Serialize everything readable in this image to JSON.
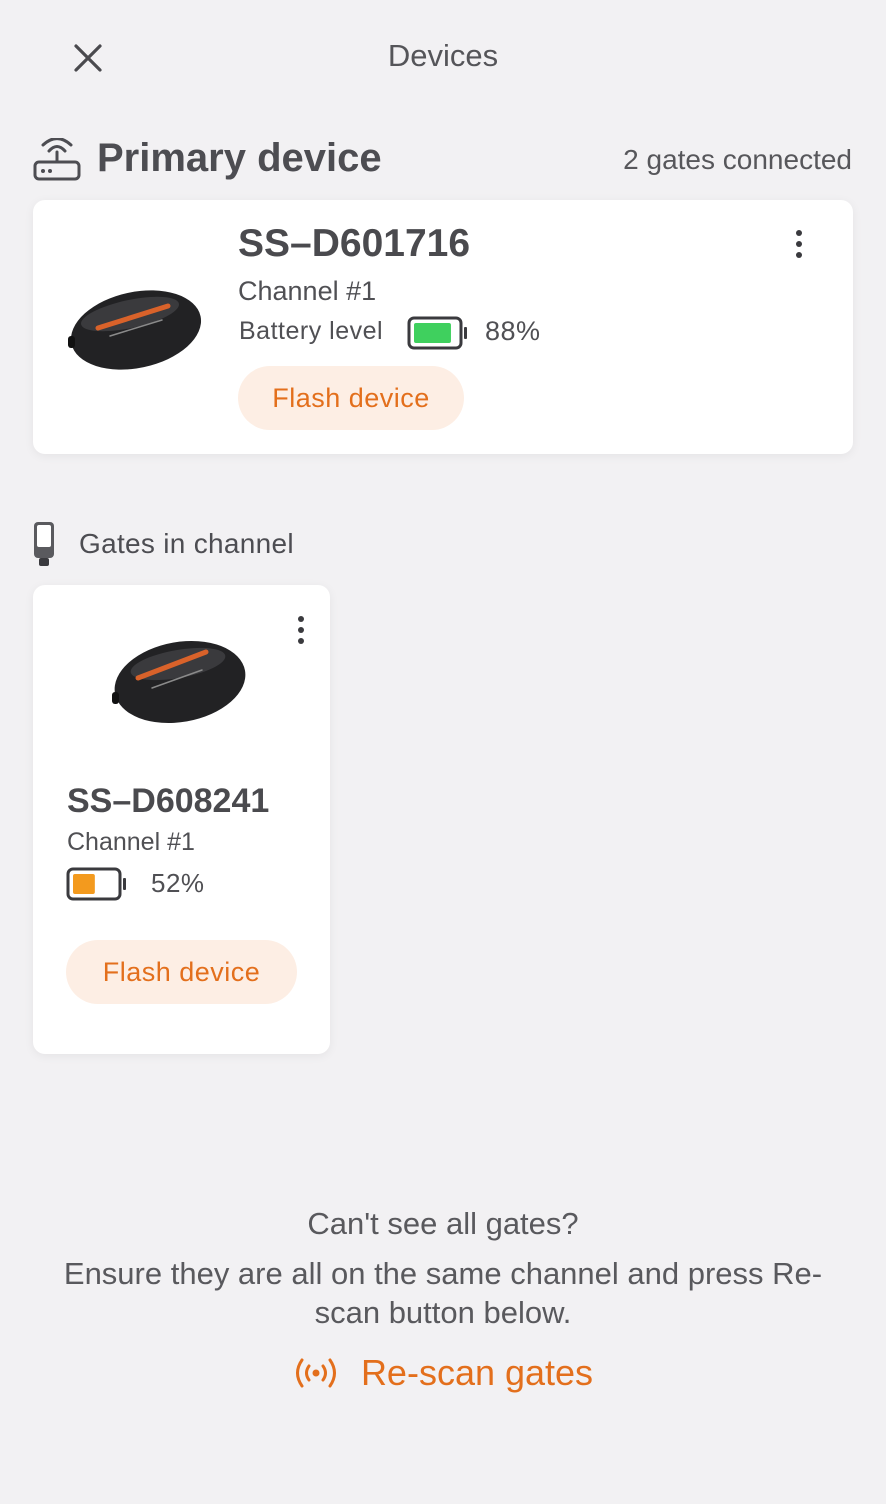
{
  "header": {
    "title": "Devices"
  },
  "primary": {
    "section_title": "Primary device",
    "gates_connected": "2 gates connected",
    "device": {
      "name": "SS–D601716",
      "channel": "Channel #1",
      "battery_label": "Battery level",
      "battery_percent": "88%",
      "battery_level": 0.88,
      "battery_color": "#3fd05e",
      "flash_label": "Flash device"
    }
  },
  "gates": {
    "section_title": "Gates in channel",
    "items": [
      {
        "name": "SS–D608241",
        "channel": "Channel #1",
        "battery_percent": "52%",
        "battery_level": 0.52,
        "battery_color": "#f39a1e",
        "flash_label": "Flash device"
      }
    ]
  },
  "footer": {
    "question": "Can't see all gates?",
    "instructions": "Ensure they are all on the same channel and press Re-scan button below.",
    "rescan_label": "Re-scan gates"
  },
  "icons": {
    "close": "close-icon",
    "router": "router-icon",
    "gate": "gate-device-icon",
    "more": "more-vertical-icon",
    "rescan": "broadcast-icon"
  },
  "colors": {
    "accent": "#e36f1c",
    "accent_bg": "#fdeee4",
    "background": "#f2f1f3",
    "card": "#ffffff"
  }
}
